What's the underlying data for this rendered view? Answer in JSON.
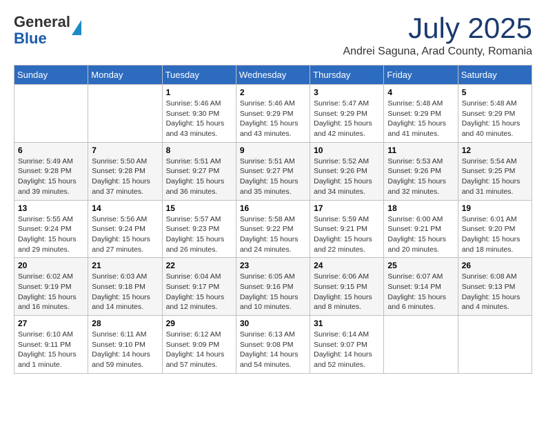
{
  "header": {
    "logo_general": "General",
    "logo_blue": "Blue",
    "month": "July 2025",
    "location": "Andrei Saguna, Arad County, Romania"
  },
  "weekdays": [
    "Sunday",
    "Monday",
    "Tuesday",
    "Wednesday",
    "Thursday",
    "Friday",
    "Saturday"
  ],
  "weeks": [
    [
      {
        "day": "",
        "info": ""
      },
      {
        "day": "",
        "info": ""
      },
      {
        "day": "1",
        "info": "Sunrise: 5:46 AM\nSunset: 9:30 PM\nDaylight: 15 hours and 43 minutes."
      },
      {
        "day": "2",
        "info": "Sunrise: 5:46 AM\nSunset: 9:29 PM\nDaylight: 15 hours and 43 minutes."
      },
      {
        "day": "3",
        "info": "Sunrise: 5:47 AM\nSunset: 9:29 PM\nDaylight: 15 hours and 42 minutes."
      },
      {
        "day": "4",
        "info": "Sunrise: 5:48 AM\nSunset: 9:29 PM\nDaylight: 15 hours and 41 minutes."
      },
      {
        "day": "5",
        "info": "Sunrise: 5:48 AM\nSunset: 9:29 PM\nDaylight: 15 hours and 40 minutes."
      }
    ],
    [
      {
        "day": "6",
        "info": "Sunrise: 5:49 AM\nSunset: 9:28 PM\nDaylight: 15 hours and 39 minutes."
      },
      {
        "day": "7",
        "info": "Sunrise: 5:50 AM\nSunset: 9:28 PM\nDaylight: 15 hours and 37 minutes."
      },
      {
        "day": "8",
        "info": "Sunrise: 5:51 AM\nSunset: 9:27 PM\nDaylight: 15 hours and 36 minutes."
      },
      {
        "day": "9",
        "info": "Sunrise: 5:51 AM\nSunset: 9:27 PM\nDaylight: 15 hours and 35 minutes."
      },
      {
        "day": "10",
        "info": "Sunrise: 5:52 AM\nSunset: 9:26 PM\nDaylight: 15 hours and 34 minutes."
      },
      {
        "day": "11",
        "info": "Sunrise: 5:53 AM\nSunset: 9:26 PM\nDaylight: 15 hours and 32 minutes."
      },
      {
        "day": "12",
        "info": "Sunrise: 5:54 AM\nSunset: 9:25 PM\nDaylight: 15 hours and 31 minutes."
      }
    ],
    [
      {
        "day": "13",
        "info": "Sunrise: 5:55 AM\nSunset: 9:24 PM\nDaylight: 15 hours and 29 minutes."
      },
      {
        "day": "14",
        "info": "Sunrise: 5:56 AM\nSunset: 9:24 PM\nDaylight: 15 hours and 27 minutes."
      },
      {
        "day": "15",
        "info": "Sunrise: 5:57 AM\nSunset: 9:23 PM\nDaylight: 15 hours and 26 minutes."
      },
      {
        "day": "16",
        "info": "Sunrise: 5:58 AM\nSunset: 9:22 PM\nDaylight: 15 hours and 24 minutes."
      },
      {
        "day": "17",
        "info": "Sunrise: 5:59 AM\nSunset: 9:21 PM\nDaylight: 15 hours and 22 minutes."
      },
      {
        "day": "18",
        "info": "Sunrise: 6:00 AM\nSunset: 9:21 PM\nDaylight: 15 hours and 20 minutes."
      },
      {
        "day": "19",
        "info": "Sunrise: 6:01 AM\nSunset: 9:20 PM\nDaylight: 15 hours and 18 minutes."
      }
    ],
    [
      {
        "day": "20",
        "info": "Sunrise: 6:02 AM\nSunset: 9:19 PM\nDaylight: 15 hours and 16 minutes."
      },
      {
        "day": "21",
        "info": "Sunrise: 6:03 AM\nSunset: 9:18 PM\nDaylight: 15 hours and 14 minutes."
      },
      {
        "day": "22",
        "info": "Sunrise: 6:04 AM\nSunset: 9:17 PM\nDaylight: 15 hours and 12 minutes."
      },
      {
        "day": "23",
        "info": "Sunrise: 6:05 AM\nSunset: 9:16 PM\nDaylight: 15 hours and 10 minutes."
      },
      {
        "day": "24",
        "info": "Sunrise: 6:06 AM\nSunset: 9:15 PM\nDaylight: 15 hours and 8 minutes."
      },
      {
        "day": "25",
        "info": "Sunrise: 6:07 AM\nSunset: 9:14 PM\nDaylight: 15 hours and 6 minutes."
      },
      {
        "day": "26",
        "info": "Sunrise: 6:08 AM\nSunset: 9:13 PM\nDaylight: 15 hours and 4 minutes."
      }
    ],
    [
      {
        "day": "27",
        "info": "Sunrise: 6:10 AM\nSunset: 9:11 PM\nDaylight: 15 hours and 1 minute."
      },
      {
        "day": "28",
        "info": "Sunrise: 6:11 AM\nSunset: 9:10 PM\nDaylight: 14 hours and 59 minutes."
      },
      {
        "day": "29",
        "info": "Sunrise: 6:12 AM\nSunset: 9:09 PM\nDaylight: 14 hours and 57 minutes."
      },
      {
        "day": "30",
        "info": "Sunrise: 6:13 AM\nSunset: 9:08 PM\nDaylight: 14 hours and 54 minutes."
      },
      {
        "day": "31",
        "info": "Sunrise: 6:14 AM\nSunset: 9:07 PM\nDaylight: 14 hours and 52 minutes."
      },
      {
        "day": "",
        "info": ""
      },
      {
        "day": "",
        "info": ""
      }
    ]
  ]
}
